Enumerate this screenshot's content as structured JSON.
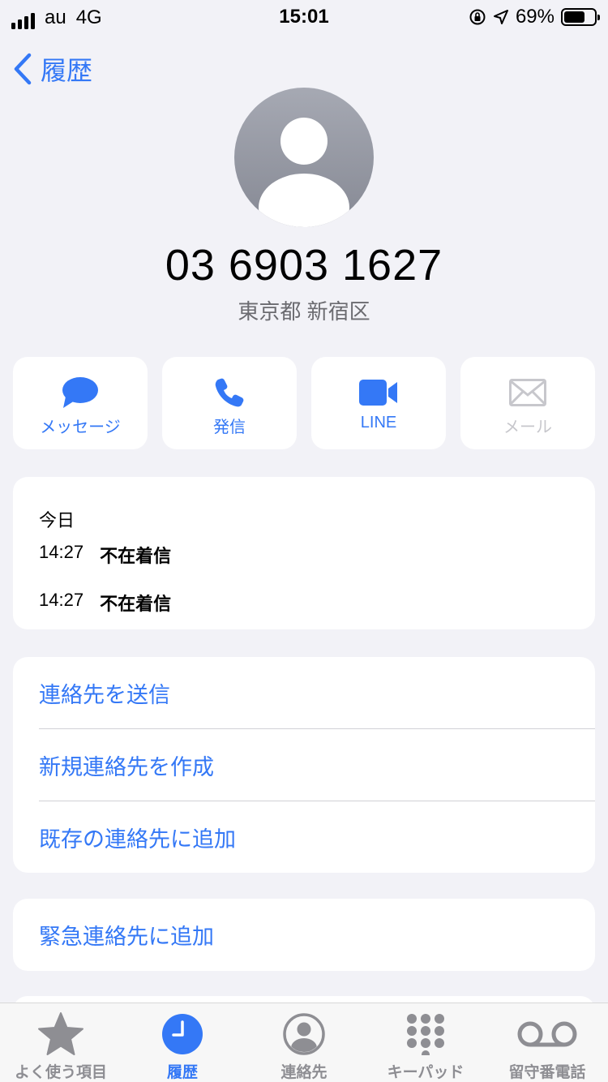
{
  "status_bar": {
    "carrier": "au",
    "network": "4G",
    "time": "15:01",
    "battery_percent": "69%",
    "battery_level": 0.69
  },
  "nav": {
    "back_label": "履歴"
  },
  "contact": {
    "phone_number": "03 6903 1627",
    "location": "東京都 新宿区"
  },
  "actions": [
    {
      "label": "メッセージ",
      "icon": "message-icon",
      "enabled": true
    },
    {
      "label": "発信",
      "icon": "phone-icon",
      "enabled": true
    },
    {
      "label": "LINE",
      "icon": "video-icon",
      "enabled": true
    },
    {
      "label": "メール",
      "icon": "mail-icon",
      "enabled": false
    }
  ],
  "history": {
    "day": "今日",
    "entries": [
      {
        "time": "14:27",
        "type": "不在着信"
      },
      {
        "time": "14:27",
        "type": "不在着信"
      }
    ]
  },
  "contact_actions": [
    "連絡先を送信",
    "新規連絡先を作成",
    "既存の連絡先に追加"
  ],
  "emergency_action": "緊急連絡先に追加",
  "tabs": [
    {
      "label": "よく使う項目",
      "icon": "star-icon",
      "active": false
    },
    {
      "label": "履歴",
      "icon": "clock-icon",
      "active": true
    },
    {
      "label": "連絡先",
      "icon": "person-circle-icon",
      "active": false
    },
    {
      "label": "キーパッド",
      "icon": "keypad-icon",
      "active": false
    },
    {
      "label": "留守番電話",
      "icon": "voicemail-icon",
      "active": false
    }
  ],
  "colors": {
    "accent": "#3478f6",
    "background": "#f2f2f7",
    "disabled": "#c7c7cc",
    "inactive_tab": "#8e8e93"
  }
}
